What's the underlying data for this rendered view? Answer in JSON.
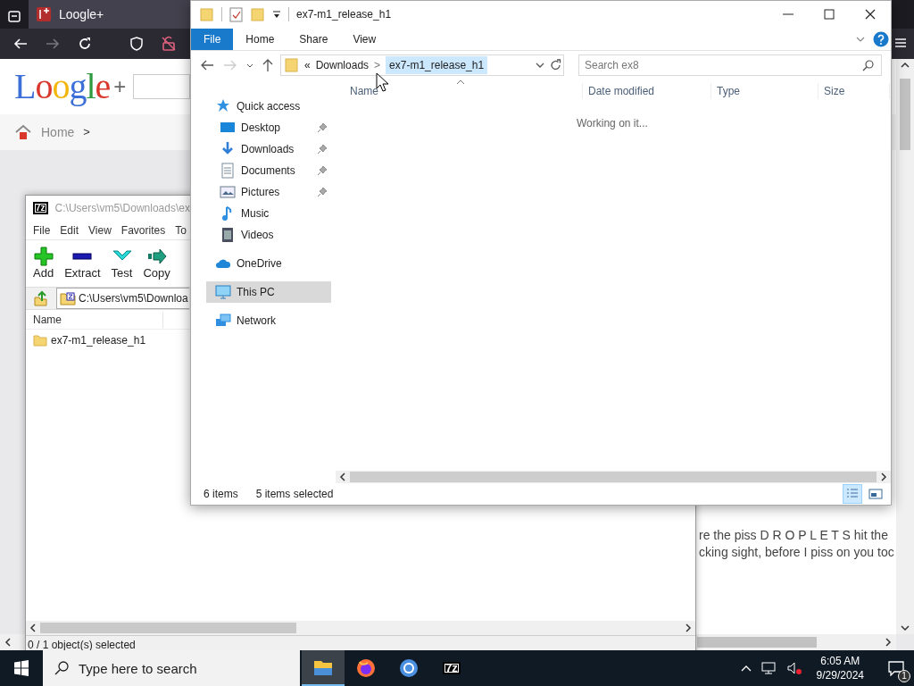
{
  "browser": {
    "tab": {
      "title": "Loogle+"
    },
    "logo": {
      "word": "Loogle",
      "plus": "+"
    },
    "breadcrumb": {
      "home": "Home",
      "separator": ">"
    },
    "paragraph_lines": [
      "re the piss D R O P L E T S hit the",
      "cking sight, before I piss on you toc"
    ]
  },
  "archive_window": {
    "icon_label": "7z",
    "title": "C:\\Users\\vm5\\Downloads\\ex",
    "menu": [
      "File",
      "Edit",
      "View",
      "Favorites",
      "To"
    ],
    "toolbar": [
      {
        "kind": "add",
        "label": "Add"
      },
      {
        "kind": "extract",
        "label": "Extract"
      },
      {
        "kind": "test",
        "label": "Test"
      },
      {
        "kind": "copy",
        "label": "Copy"
      }
    ],
    "path": "C:\\Users\\vm5\\Downloa",
    "columns": [
      "Name"
    ],
    "rows": [
      {
        "name": "ex7-m1_release_h1",
        "selected": false
      }
    ],
    "status": "0 / 1 object(s) selected"
  },
  "explorer": {
    "title": "ex7-m1_release_h1",
    "ribbon_tabs": [
      {
        "label": "File",
        "selected": true
      },
      {
        "label": "Home",
        "selected": false
      },
      {
        "label": "Share",
        "selected": false
      },
      {
        "label": "View",
        "selected": false
      }
    ],
    "address": {
      "overflow": "«",
      "parent": "Downloads",
      "separator": ">",
      "current": "ex7-m1_release_h1",
      "highlighted": true
    },
    "search": {
      "placeholder": "Search ex8"
    },
    "nav": [
      {
        "label": "Quick access",
        "kind": "star",
        "selected": false,
        "children": [
          {
            "label": "Desktop",
            "kind": "desktop",
            "pinned": true,
            "selected": false
          },
          {
            "label": "Downloads",
            "kind": "download",
            "pinned": true,
            "selected": false
          },
          {
            "label": "Documents",
            "kind": "document",
            "pinned": true,
            "selected": false
          },
          {
            "label": "Pictures",
            "kind": "pictures",
            "pinned": true,
            "selected": false
          },
          {
            "label": "Music",
            "kind": "music",
            "pinned": false,
            "selected": false
          },
          {
            "label": "Videos",
            "kind": "video",
            "pinned": false,
            "selected": false
          }
        ]
      },
      {
        "label": "OneDrive",
        "kind": "cloud",
        "selected": false
      },
      {
        "label": "This PC",
        "kind": "pc",
        "selected": true
      },
      {
        "label": "Network",
        "kind": "network",
        "selected": false
      }
    ],
    "columns": [
      "Name",
      "Date modified",
      "Type",
      "Size"
    ],
    "message": "Working on it...",
    "status": {
      "items": "6 items",
      "selected": "5 items selected"
    },
    "views": [
      {
        "kind": "details",
        "selected": true
      },
      {
        "kind": "thumbnails",
        "selected": false
      }
    ]
  },
  "taskbar": {
    "search": {
      "placeholder": "Type here to search"
    },
    "apps": [
      {
        "kind": "explorer",
        "selected": true
      },
      {
        "kind": "firefox",
        "selected": false
      },
      {
        "kind": "chrome",
        "selected": false
      },
      {
        "kind": "sevenzip",
        "label": "7z",
        "selected": false
      }
    ],
    "time": "6:05 AM",
    "date": "9/29/2024",
    "notifications": "1"
  }
}
